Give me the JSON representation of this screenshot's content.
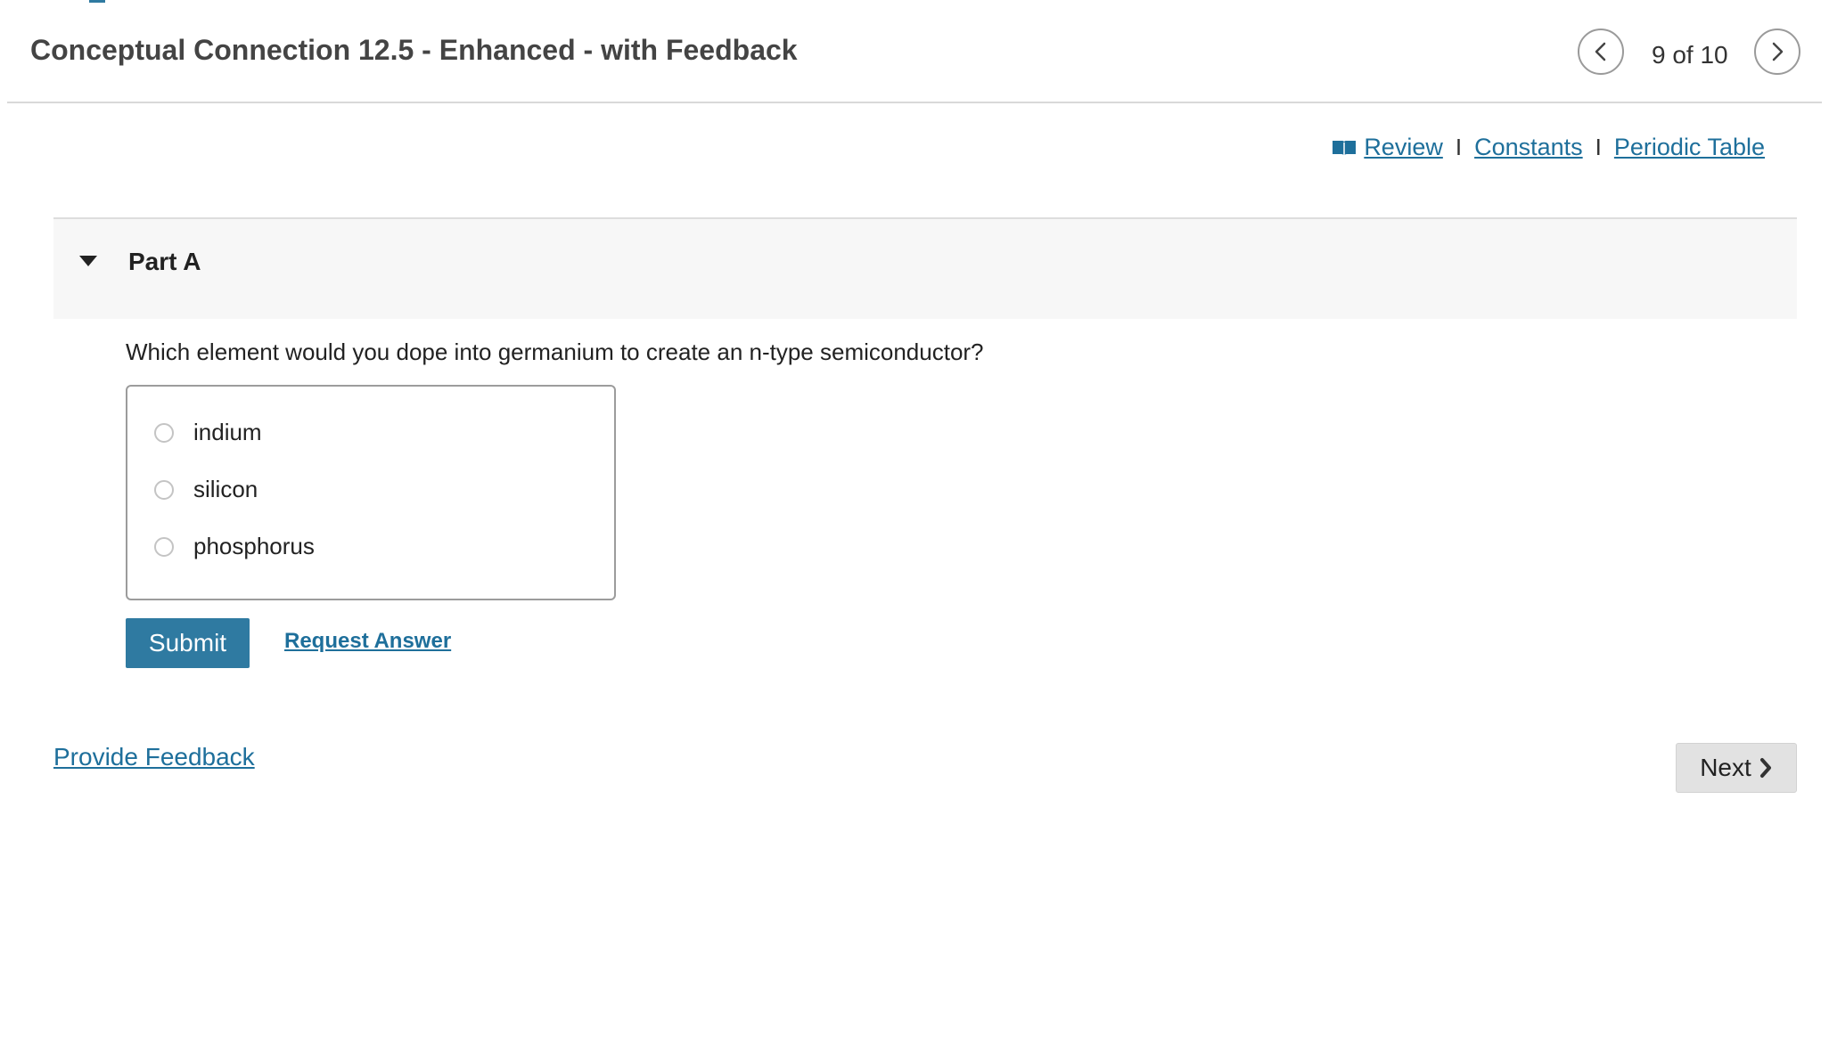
{
  "header": {
    "title": "Conceptual Connection 12.5 - Enhanced - with Feedback",
    "pagination": "9 of 10",
    "prev_icon": "chevron-left-icon",
    "next_icon": "chevron-right-icon"
  },
  "resources": {
    "book_icon": "book-icon",
    "links": [
      {
        "label": " Review"
      },
      {
        "label": "Constants"
      },
      {
        "label": "Periodic Table"
      }
    ],
    "separator": "I"
  },
  "part": {
    "title": "Part A",
    "caret_icon": "caret-down-icon",
    "question": "Which element would you dope into germanium to create an n-type semiconductor?",
    "choices": [
      {
        "label": "indium"
      },
      {
        "label": "silicon"
      },
      {
        "label": "phosphorus"
      }
    ],
    "submit_label": "Submit",
    "request_answer_label": "Request Answer"
  },
  "footer": {
    "feedback_label": "Provide Feedback",
    "next_label": "Next"
  },
  "colors": {
    "link": "#1e6f9b",
    "primary": "#2f7aa1",
    "title_text": "#444444"
  }
}
